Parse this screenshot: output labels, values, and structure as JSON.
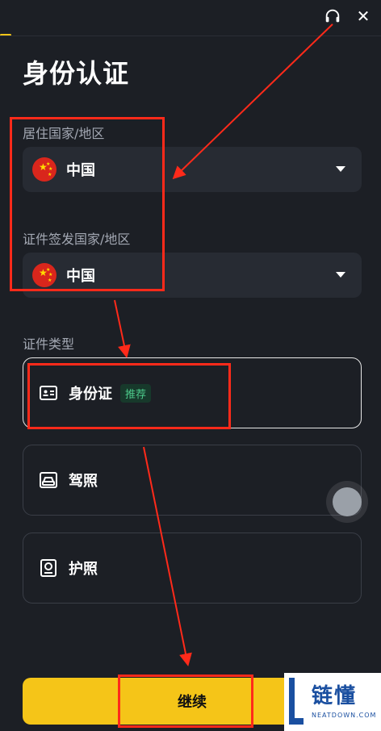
{
  "header": {
    "close_label": "✕"
  },
  "title": "身份认证",
  "residence": {
    "label": "居住国家/地区",
    "value": "中国"
  },
  "issuing": {
    "label": "证件签发国家/地区",
    "value": "中国"
  },
  "doc_type": {
    "label": "证件类型",
    "options": [
      {
        "label": "身份证",
        "badge": "推荐",
        "icon": "id-card-icon"
      },
      {
        "label": "驾照",
        "icon": "drivers-license-icon"
      },
      {
        "label": "护照",
        "icon": "passport-icon"
      }
    ]
  },
  "continue_label": "继续",
  "watermark": {
    "title": "链懂",
    "sub": "NEATDOWN.COM"
  },
  "colors": {
    "accent": "#f5c518",
    "background": "#1c1f25",
    "field": "#272b33",
    "annotation": "#ff2a1a",
    "badge_text": "#4cc98a"
  }
}
